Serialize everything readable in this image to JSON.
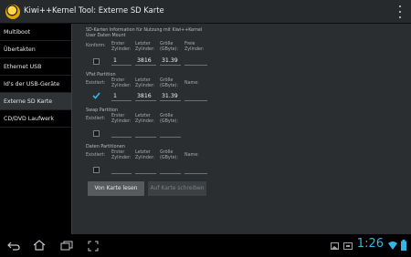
{
  "actionbar": {
    "title": "Kiwi++Kernel Tool: Externe SD Karte"
  },
  "sidebar": {
    "items": [
      {
        "label": "Multiboot"
      },
      {
        "label": "Übertakten"
      },
      {
        "label": "Ethernet USB"
      },
      {
        "label": "Id's der USB-Geräte"
      },
      {
        "label": "Externe SD Karte"
      },
      {
        "label": "CD/DVD Laufwerk"
      }
    ]
  },
  "main": {
    "info": {
      "line1": "SD-Karten Information für Nutzung mit Kiwi++Kernel",
      "line2": "User Daten Mount",
      "konform_label": "Konform:",
      "col_erster": "Erster\nZylinder:",
      "col_letzter": "Letzter\nZylinder:",
      "col_groesse": "Größe\n(GByte):",
      "col_freie": "Freie\nZylinder:",
      "erster": "1",
      "letzter": "3816",
      "groesse": "31.39",
      "freie": ""
    },
    "vfat": {
      "title": "VFat Partition",
      "exists_label": "Existiert:",
      "col_erster": "Erster\nZylinder:",
      "col_letzter": "Letzter\nZylinder:",
      "col_groesse": "Größe\n(GByte):",
      "col_name": "Name:",
      "erster": "1",
      "letzter": "3816",
      "groesse": "31.39",
      "name": ""
    },
    "swap": {
      "title": "Swap Partition",
      "exists_label": "Existiert:",
      "col_erster": "Erster\nZylinder:",
      "col_letzter": "Letzter\nZylinder:",
      "col_groesse": "Größe\n(GByte):",
      "erster": "",
      "letzter": "",
      "groesse": ""
    },
    "daten": {
      "title": "Daten Partitionen",
      "exists_label": "Existiert:",
      "col_erster": "Erster\nZylinder:",
      "col_letzter": "Letzter\nZylinder:",
      "col_groesse": "Größe\n(GByte):",
      "col_name": "Name:",
      "erster": "",
      "letzter": "",
      "groesse": "",
      "name": ""
    },
    "buttons": {
      "read": "Von Karte lesen",
      "write": "Auf Karte schreiben"
    }
  },
  "sysbar": {
    "time": "1:26"
  },
  "colors": {
    "accent_blue": "#35b5e5",
    "check_blue": "#33b5e5"
  }
}
